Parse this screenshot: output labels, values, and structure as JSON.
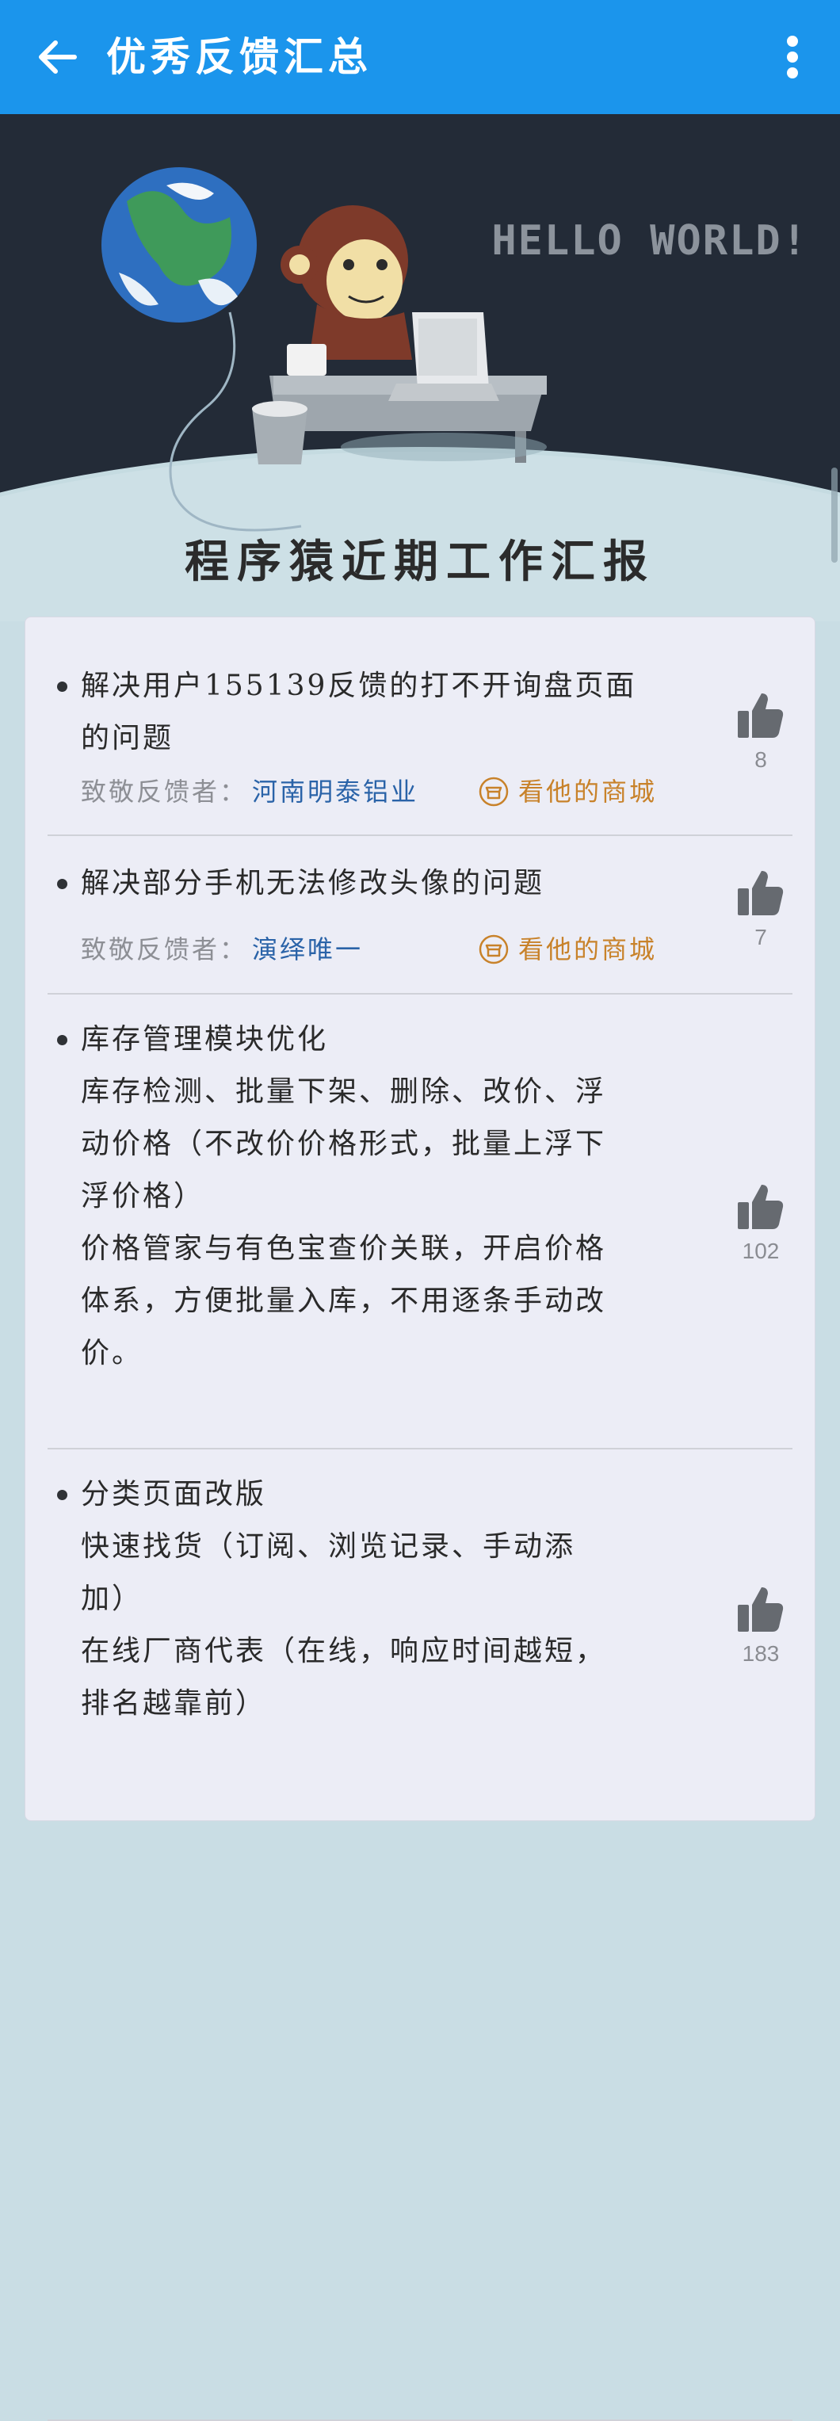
{
  "appbar": {
    "title": "优秀反馈汇总",
    "back_icon": "arrow-left-icon",
    "menu_icon": "more-vertical-icon",
    "bg_color": "#1b95ec"
  },
  "banner": {
    "hello_text": "HELLO WORLD!",
    "title": "程序猿近期工作汇报"
  },
  "feedback": [
    {
      "lines": [
        "解决用户155139反馈的打不开询盘页面",
        "的问题"
      ],
      "credit_label": "致敬反馈者：",
      "credit_name": "河南明泰铝业",
      "shop_label": "看他的商城",
      "likes": "8"
    },
    {
      "lines": [
        "解决部分手机无法修改头像的问题"
      ],
      "credit_label": "致敬反馈者：",
      "credit_name": "演绎唯一",
      "shop_label": "看他的商城",
      "likes": "7"
    },
    {
      "lines": [
        "库存管理模块优化",
        "库存检测、批量下架、删除、改价、浮",
        "动价格（不改价价格形式，批量上浮下",
        "浮价格）",
        "价格管家与有色宝查价关联，开启价格",
        "体系，方便批量入库，不用逐条手动改",
        "价。"
      ],
      "likes": "102"
    },
    {
      "lines": [
        "分类页面改版",
        "快速找货（订阅、浏览记录、手动添",
        "加）",
        "在线厂商代表（在线，响应时间越短，",
        "排名越靠前）"
      ],
      "likes": "183"
    }
  ],
  "colors": {
    "credit_name": "#2a63a8",
    "shop_link": "#c8822a",
    "like_icon": "#666a70"
  }
}
